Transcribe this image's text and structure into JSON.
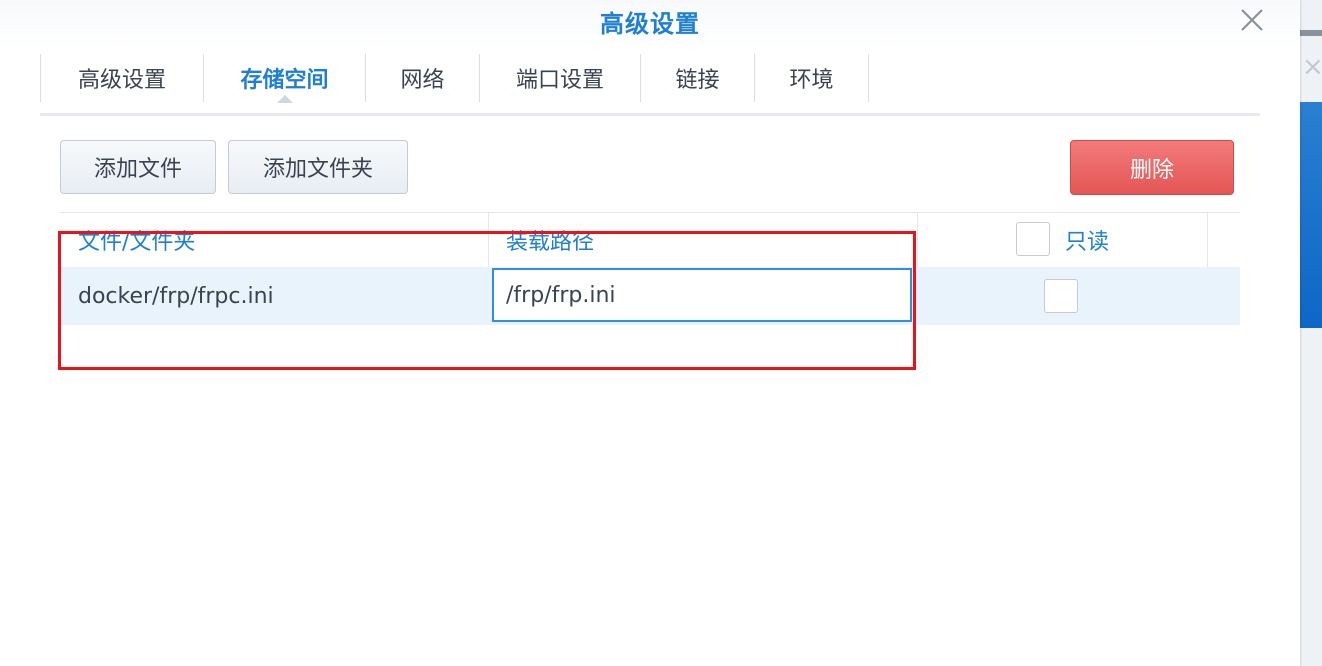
{
  "dialog": {
    "title": "高级设置",
    "close_icon": "close-icon"
  },
  "tabs": [
    {
      "label": "高级设置",
      "active": false
    },
    {
      "label": "存储空间",
      "active": true
    },
    {
      "label": "网络",
      "active": false
    },
    {
      "label": "端口设置",
      "active": false
    },
    {
      "label": "链接",
      "active": false
    },
    {
      "label": "环境",
      "active": false
    }
  ],
  "toolbar": {
    "add_file_label": "添加文件",
    "add_folder_label": "添加文件夹",
    "delete_label": "删除"
  },
  "table": {
    "columns": {
      "file_folder": "文件/文件夹",
      "mount_path": "装载路径",
      "readonly": "只读"
    },
    "rows": [
      {
        "file_folder": "docker/frp/frpc.ini",
        "mount_path": "/frp/frp.ini",
        "readonly": false
      }
    ]
  },
  "colors": {
    "accent": "#1f7fd4",
    "delete_button": "#e45656",
    "selected_row": "#e9f3fc",
    "annotation_border": "#e8141c"
  }
}
